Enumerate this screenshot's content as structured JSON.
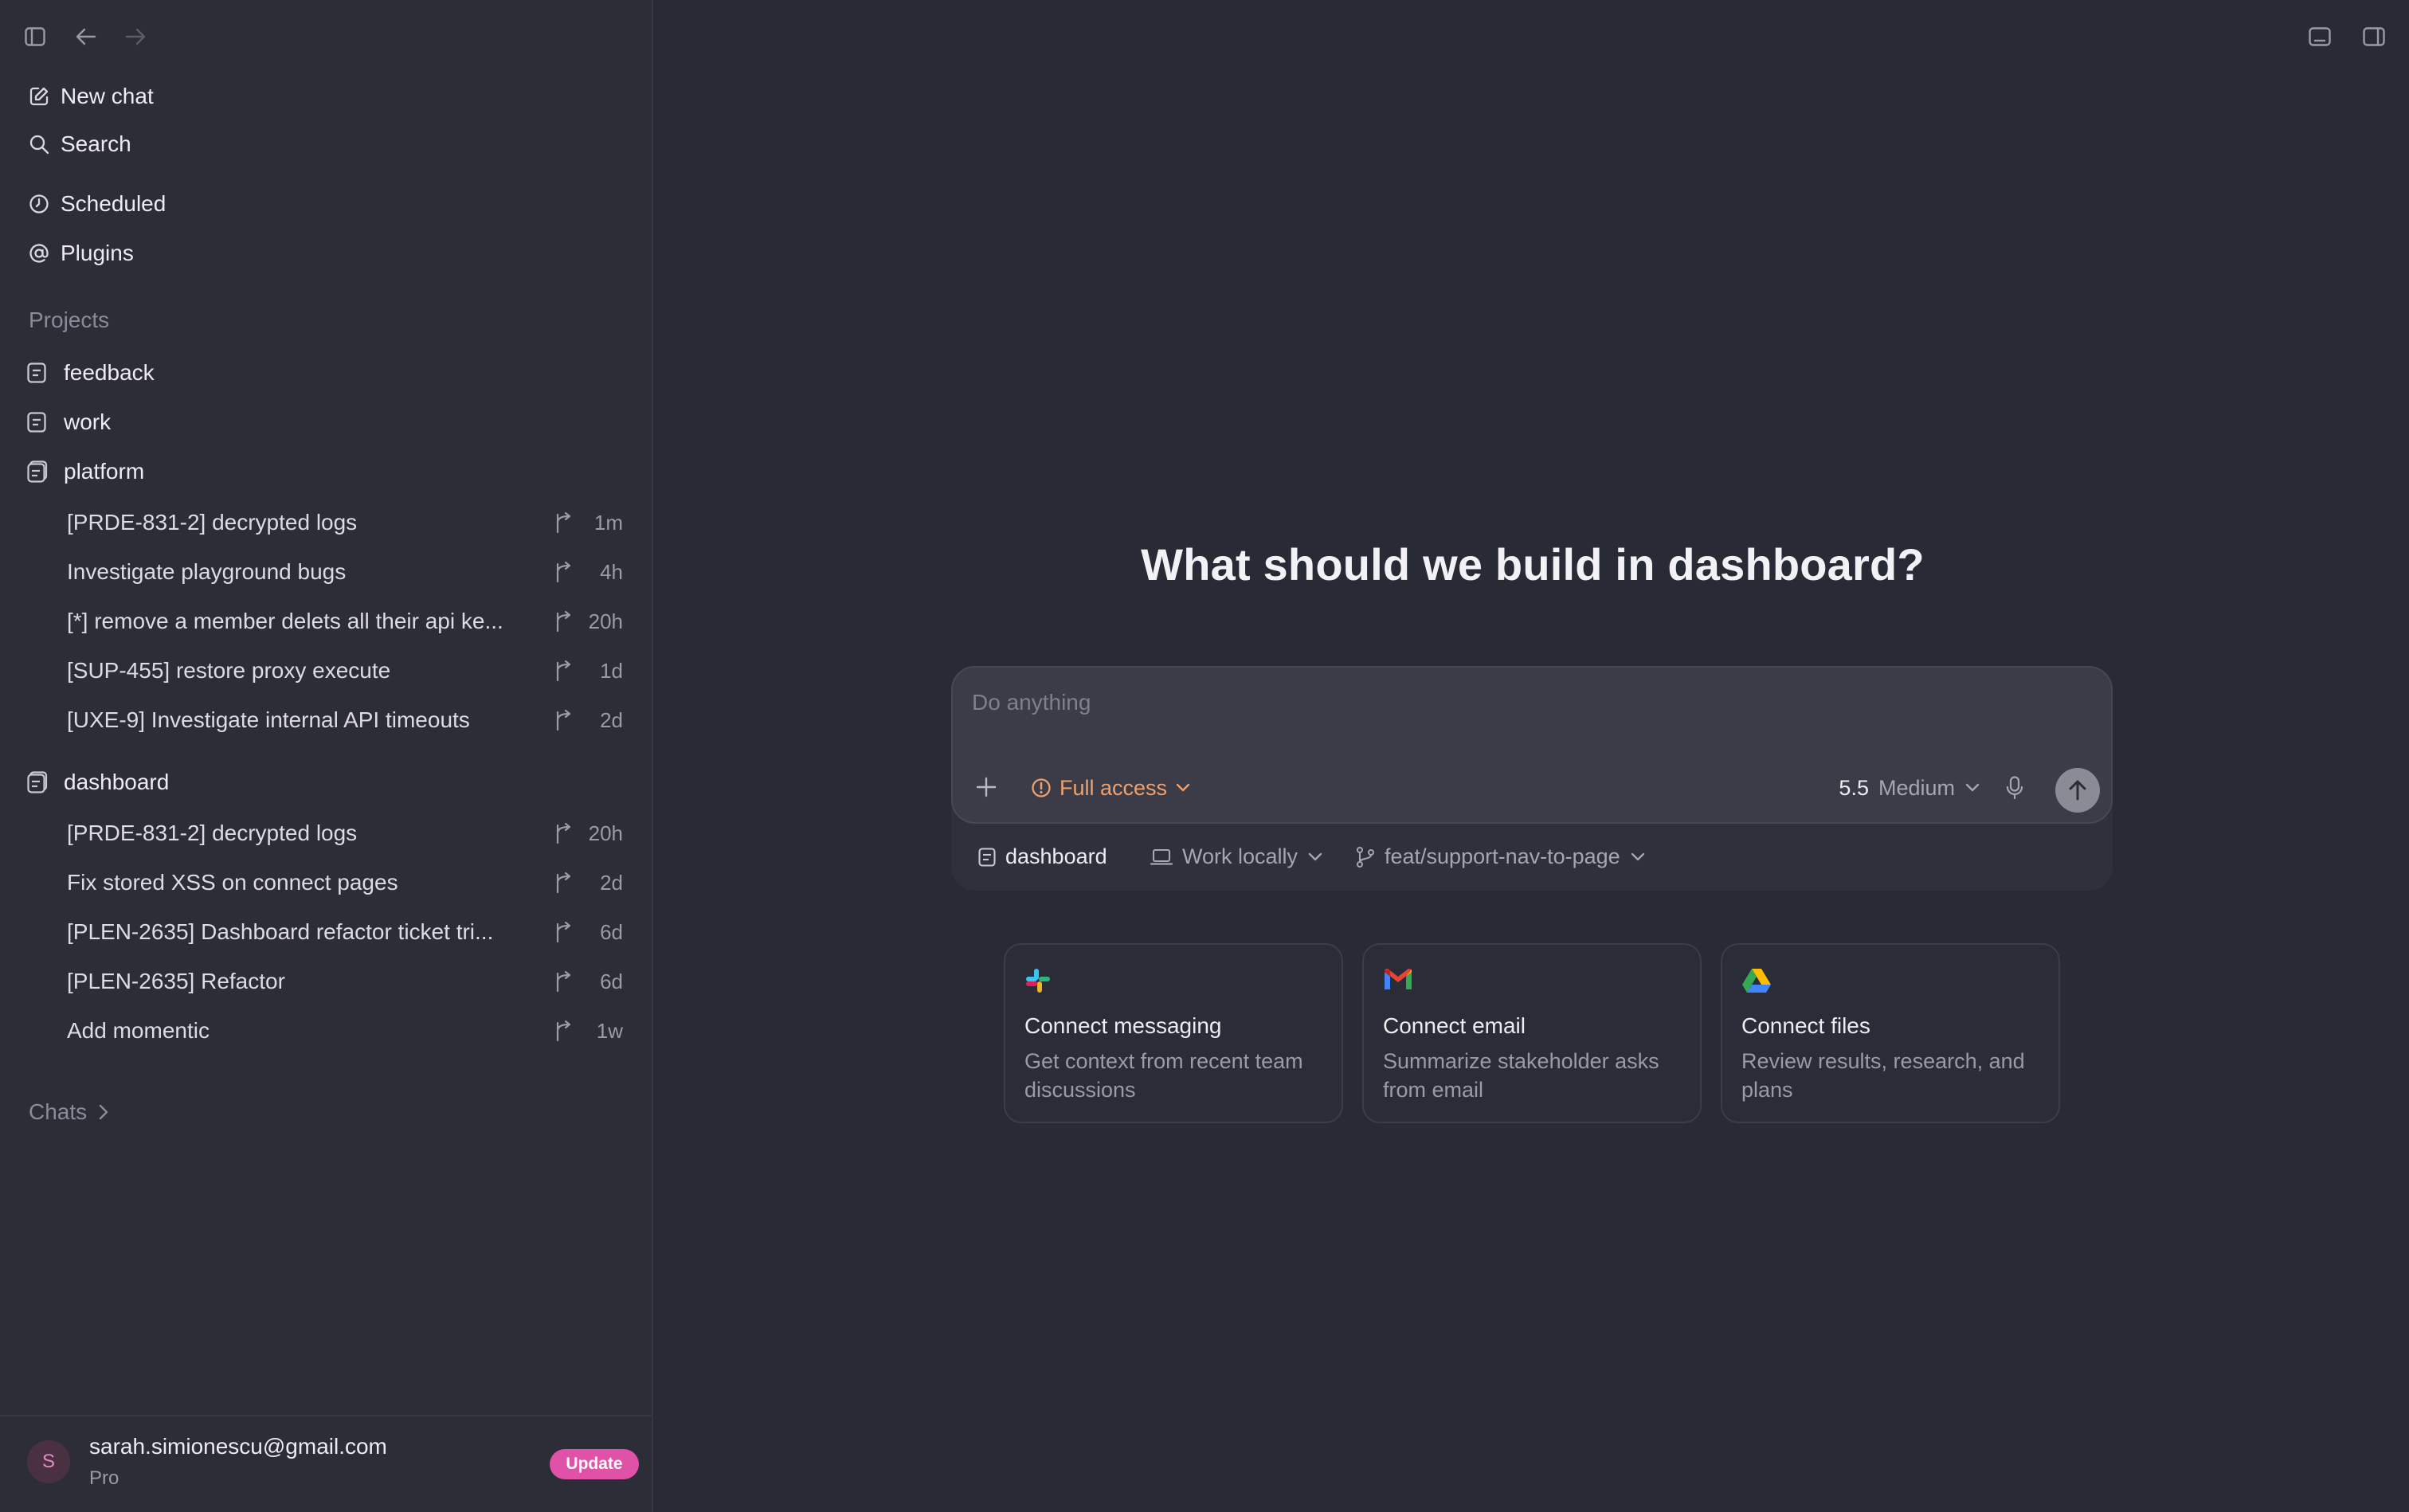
{
  "sidebar": {
    "nav": [
      {
        "label": "New chat",
        "icon": "compose-icon"
      },
      {
        "label": "Search",
        "icon": "search-icon"
      },
      {
        "label": "Scheduled",
        "icon": "clock-icon"
      },
      {
        "label": "Plugins",
        "icon": "at-icon"
      }
    ],
    "projects_label": "Projects",
    "projects": [
      {
        "label": "feedback"
      },
      {
        "label": "work"
      },
      {
        "label": "platform"
      },
      {
        "label": "dashboard"
      }
    ],
    "platform_threads": [
      {
        "title": "[PRDE-831-2] decrypted logs",
        "time": "1m"
      },
      {
        "title": "Investigate playground bugs",
        "time": "4h"
      },
      {
        "title": "[*] remove a member delets all their api ke...",
        "time": "20h"
      },
      {
        "title": "[SUP-455] restore proxy execute",
        "time": "1d"
      },
      {
        "title": "[UXE-9] Investigate internal API timeouts",
        "time": "2d"
      }
    ],
    "dashboard_threads": [
      {
        "title": "[PRDE-831-2] decrypted logs",
        "time": "20h"
      },
      {
        "title": "Fix stored XSS on connect pages",
        "time": "2d"
      },
      {
        "title": "[PLEN-2635] Dashboard refactor ticket tri...",
        "time": "6d"
      },
      {
        "title": "[PLEN-2635] Refactor",
        "time": "6d"
      },
      {
        "title": "Add momentic",
        "time": "1w"
      }
    ],
    "chats_label": "Chats",
    "account": {
      "avatar_letter": "S",
      "email": "sarah.simionescu@gmail.com",
      "plan": "Pro",
      "update_label": "Update"
    }
  },
  "main": {
    "headline": "What should we build in dashboard?",
    "composer": {
      "placeholder": "Do anything",
      "access_label": "Full access",
      "model_version": "5.5",
      "model_effort": "Medium"
    },
    "context": {
      "project": "dashboard",
      "work_mode": "Work locally",
      "branch": "feat/support-nav-to-page"
    },
    "cards": [
      {
        "title": "Connect messaging",
        "desc": "Get context from recent team discussions",
        "icon": "slack-icon"
      },
      {
        "title": "Connect email",
        "desc": "Summarize stakeholder asks from email",
        "icon": "gmail-icon"
      },
      {
        "title": "Connect files",
        "desc": "Review results, research, and plans",
        "icon": "drive-icon"
      }
    ]
  },
  "colors": {
    "background": "#282a36",
    "sidebar": "#2c2d37",
    "accent_access": "#f0a06a",
    "update_button": "#e052a8"
  }
}
